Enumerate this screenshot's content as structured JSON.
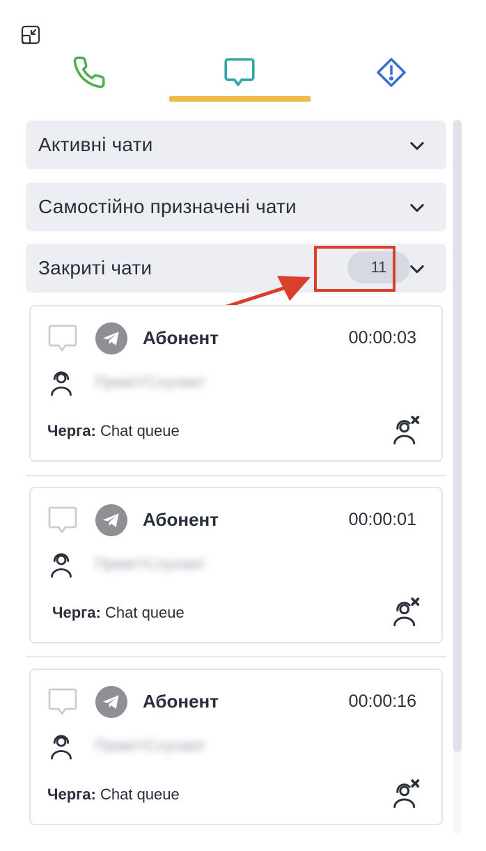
{
  "icons": {
    "collapse": "collapse-icon",
    "phone": "phone-icon",
    "chat": "chat-icon",
    "alert": "alert-icon",
    "chevron": "chevron-down-icon",
    "telegram": "telegram-icon",
    "agent": "agent-icon",
    "unassigned": "agent-remove-icon"
  },
  "colors": {
    "phone": "#4caf50",
    "chat": "#2ea6a6",
    "alert": "#3b6fd6",
    "tab_underline": "#f0bb4b",
    "highlight": "#d8402b"
  },
  "tabs": {
    "active": "chat"
  },
  "sections": [
    {
      "title": "Активні чати"
    },
    {
      "title": "Самостійно призначені чати"
    },
    {
      "title": "Закриті чати",
      "count": "11"
    }
  ],
  "chats": [
    {
      "name": "Абонент",
      "time": "00:00:03",
      "preview": "Привіт!Слухаю!",
      "queue_label": "Черга:",
      "queue": "Chat queue"
    },
    {
      "name": "Абонент",
      "time": "00:00:01",
      "preview": "Привіт!Слухаю!",
      "queue_label": "Черга:",
      "queue": "Chat queue"
    },
    {
      "name": "Абонент",
      "time": "00:00:16",
      "preview": "Привіт!Слухаю!",
      "queue_label": "Черга:",
      "queue": "Chat queue"
    }
  ]
}
